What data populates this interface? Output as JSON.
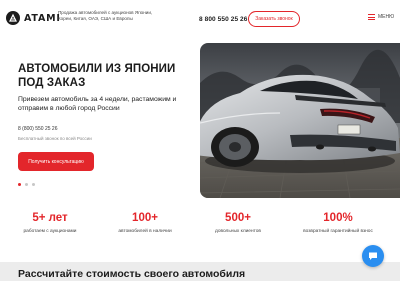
{
  "header": {
    "logo_text": "ATAMI",
    "tagline": "Продажа автомобилей с аукционов Японии, Кореи, Китая, ОАЭ, США и Европы",
    "phone": "8 800 550 25 26",
    "callback_label": "Заказать звонок",
    "menu_label": "МЕНЮ"
  },
  "hero": {
    "title": "АВТОМОБИЛИ ИЗ ЯПОНИИ ПОД ЗАКАЗ",
    "subtitle": "Привезем автомобиль за 4 недели, растаможим и отправим в любой город России",
    "phone": "8 (800) 550 25 26",
    "phone_note": "Бесплатный звонок по всей России",
    "cta_label": "Получить консультацию",
    "slides_total": 3,
    "slide_active": 1
  },
  "stats": [
    {
      "value": "5+ лет",
      "label": "работаем с аукционами"
    },
    {
      "value": "100+",
      "label": "автомобилей в наличии"
    },
    {
      "value": "500+",
      "label": "довольных клиентов"
    },
    {
      "value": "100%",
      "label": "возвратный гарантийный взнос"
    }
  ],
  "bottom": {
    "title": "Рассчитайте стоимость своего автомобиля"
  },
  "colors": {
    "accent": "#e3262b",
    "chat": "#2a8ef0",
    "text": "#1c1c1c"
  },
  "icons": {
    "logo": "logo-mark-icon",
    "menu": "hamburger-icon",
    "chat": "chat-bubble-icon"
  }
}
